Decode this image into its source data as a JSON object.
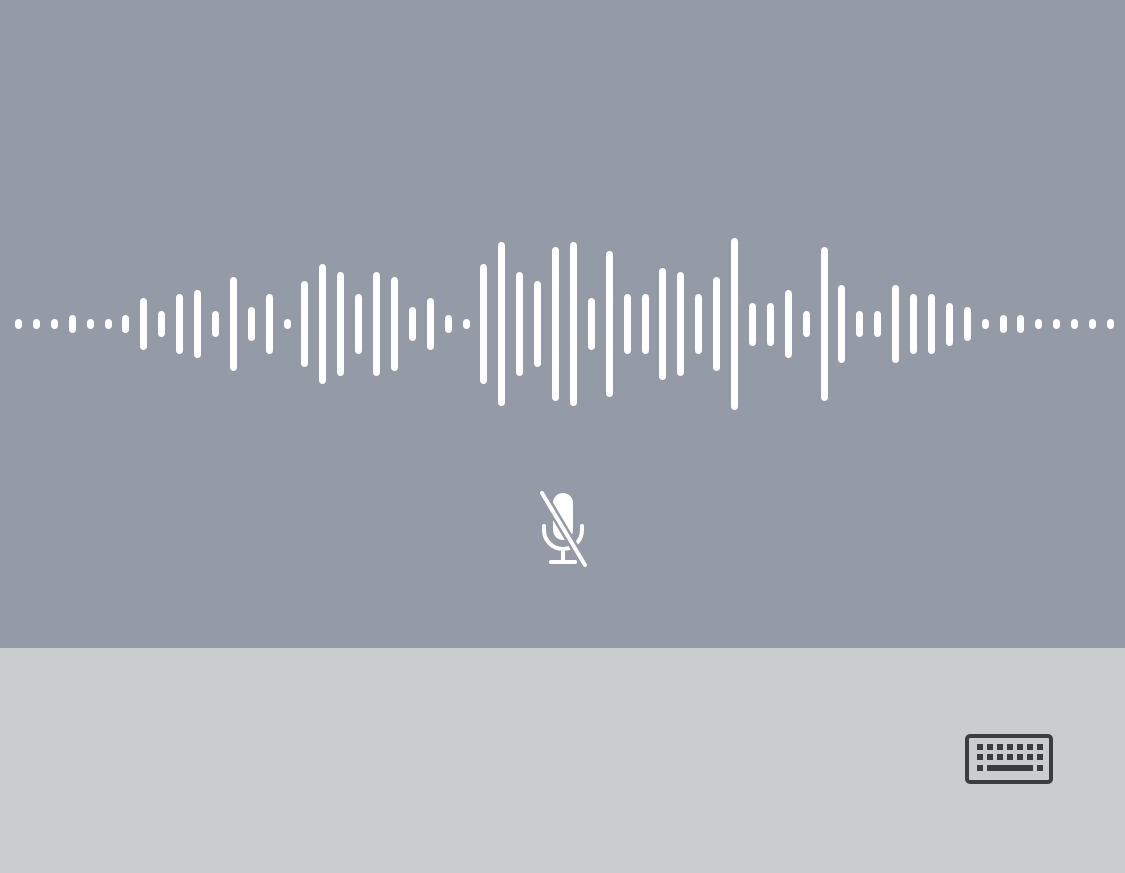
{
  "dictation": {
    "state": "listening",
    "mic_icon": "mic-off-icon",
    "waveform_levels": [
      1,
      1,
      1,
      2,
      1,
      1,
      2,
      6,
      3,
      7,
      8,
      3,
      11,
      4,
      7,
      1,
      10,
      14,
      12,
      7,
      12,
      11,
      4,
      6,
      2,
      1,
      14,
      19,
      12,
      10,
      18,
      19,
      6,
      17,
      7,
      7,
      13,
      12,
      7,
      11,
      20,
      5,
      5,
      8,
      3,
      18,
      9,
      3,
      3,
      9,
      7,
      7,
      5,
      4,
      1,
      2,
      2,
      1,
      1,
      1,
      1,
      1
    ]
  },
  "keyboard_toggle": {
    "icon": "keyboard-icon"
  },
  "colors": {
    "dictation_bg": "#959ba6",
    "keyboard_area_bg": "#cbccce",
    "wave_color": "#ffffff",
    "keyboard_icon_color": "#3a3c40"
  }
}
